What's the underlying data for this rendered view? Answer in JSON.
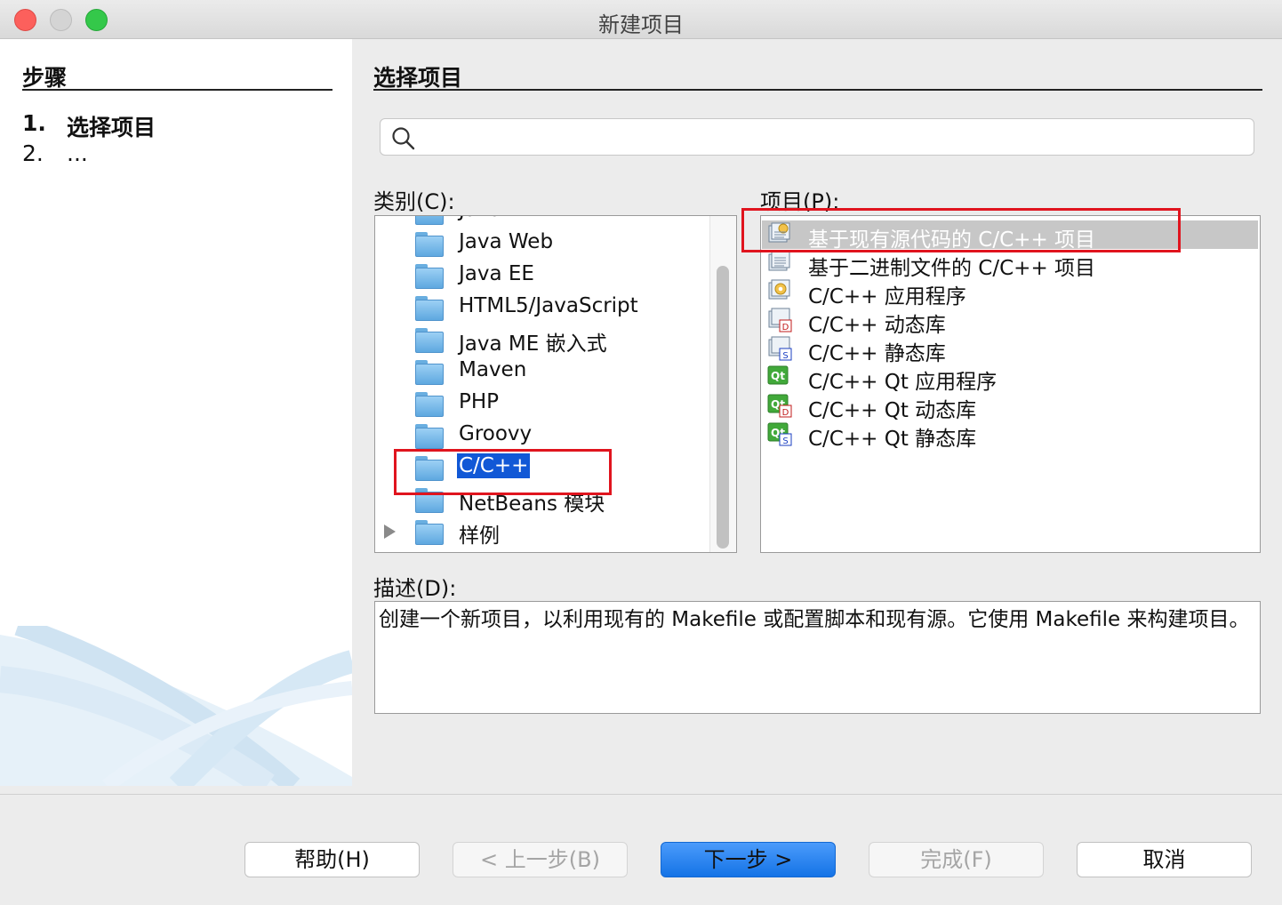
{
  "window": {
    "title": "新建项目"
  },
  "steps": {
    "title": "步骤",
    "items": [
      {
        "num": "1.",
        "label": "选择项目"
      },
      {
        "num": "2.",
        "label": "..."
      }
    ]
  },
  "main": {
    "title": "选择项目",
    "search": {
      "value": "",
      "placeholder": ""
    },
    "categories_label": "类别(C):",
    "projects_label": "项目(P):",
    "description_label": "描述(D):",
    "categories": [
      {
        "label": "JavaFX"
      },
      {
        "label": "Java Web"
      },
      {
        "label": "Java EE"
      },
      {
        "label": "HTML5/JavaScript"
      },
      {
        "label": "Java ME 嵌入式"
      },
      {
        "label": "Maven"
      },
      {
        "label": "PHP"
      },
      {
        "label": "Groovy"
      },
      {
        "label": "C/C++",
        "selected": true
      },
      {
        "label": "NetBeans 模块"
      },
      {
        "label": "样例",
        "expandable": true
      }
    ],
    "projects": [
      {
        "label": "基于现有源代码的 C/C++ 项目",
        "icon": "existing-sources-icon",
        "selected": true
      },
      {
        "label": "基于二进制文件的 C/C++ 项目",
        "icon": "binary-project-icon"
      },
      {
        "label": "C/C++ 应用程序",
        "icon": "cpp-application-icon"
      },
      {
        "label": "C/C++ 动态库",
        "icon": "cpp-dynamic-library-icon"
      },
      {
        "label": "C/C++ 静态库",
        "icon": "cpp-static-library-icon"
      },
      {
        "label": "C/C++ Qt 应用程序",
        "icon": "qt-application-icon"
      },
      {
        "label": "C/C++ Qt 动态库",
        "icon": "qt-dynamic-library-icon"
      },
      {
        "label": "C/C++ Qt 静态库",
        "icon": "qt-static-library-icon"
      }
    ],
    "description": "创建一个新项目，以利用现有的 Makefile 或配置脚本和现有源。它使用 Makefile 来构建项目。"
  },
  "buttons": {
    "help": "帮助(H)",
    "prev": "< 上一步(B)",
    "next": "下一步 >",
    "finish": "完成(F)",
    "cancel": "取消"
  },
  "colors": {
    "selection": "#1158d6",
    "annotation": "#e0141e",
    "primary_button": "#1473e6"
  }
}
